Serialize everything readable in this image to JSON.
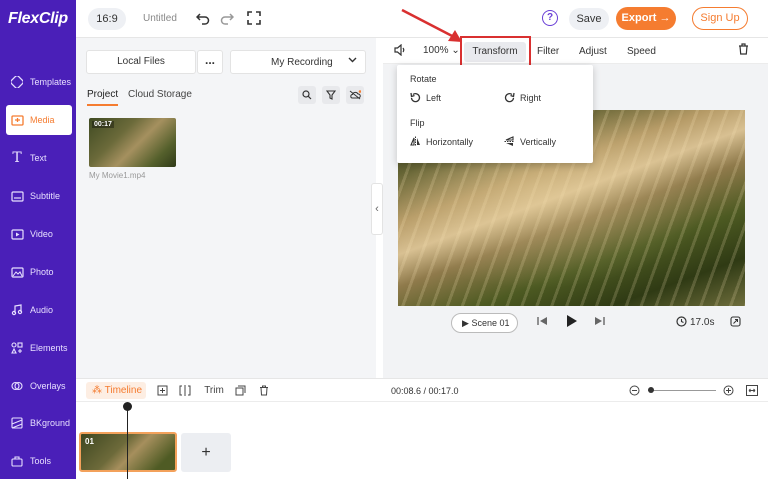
{
  "app": {
    "logo": "FlexClip",
    "ratio": "16:9",
    "project_title": "Untitled",
    "save_label": "Save",
    "export_label": "Export →",
    "signup_label": "Sign Up",
    "help_label": "?"
  },
  "sidebar": {
    "items": [
      {
        "label": "Templates",
        "icon": "templates-icon"
      },
      {
        "label": "Media",
        "icon": "media-icon"
      },
      {
        "label": "Text",
        "icon": "text-icon"
      },
      {
        "label": "Subtitle",
        "icon": "subtitle-icon"
      },
      {
        "label": "Video",
        "icon": "video-icon"
      },
      {
        "label": "Photo",
        "icon": "photo-icon"
      },
      {
        "label": "Audio",
        "icon": "audio-icon"
      },
      {
        "label": "Elements",
        "icon": "elements-icon"
      },
      {
        "label": "Overlays",
        "icon": "overlays-icon"
      },
      {
        "label": "BKground",
        "icon": "background-icon"
      },
      {
        "label": "Tools",
        "icon": "tools-icon"
      }
    ],
    "active": "Media",
    "accent": "#f57c30",
    "bg": "#4a1fb8"
  },
  "media_panel": {
    "local_files": "Local Files",
    "more": "...",
    "recording": "My Recording",
    "tabs": [
      "Project",
      "Cloud Storage"
    ],
    "active_tab": "Project",
    "media": [
      {
        "duration": "00:17",
        "name": "My Movie1.mp4"
      }
    ]
  },
  "toolbar": {
    "zoom": "100%",
    "items": [
      "Transform",
      "Filter",
      "Adjust",
      "Speed"
    ]
  },
  "transform_menu": {
    "rotate_heading": "Rotate",
    "rotate_left": "Left",
    "rotate_right": "Right",
    "flip_heading": "Flip",
    "flip_h": "Horizontally",
    "flip_v": "Vertically"
  },
  "player": {
    "scene": "Scene 01",
    "duration": "17.0s"
  },
  "timeline": {
    "tab": "Timeline",
    "trim": "Trim",
    "time": "00:08.6 / 00:17.0",
    "clip_number": "01",
    "add_label": "+"
  }
}
